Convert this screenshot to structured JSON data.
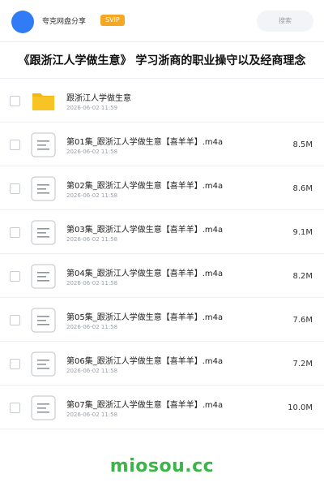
{
  "header": {
    "app_name": "夸克网盘分享",
    "badge": "SVIP",
    "search_placeholder": "搜索"
  },
  "title": "《跟浙江人学做生意》 学习浙商的职业操守以及经商理念",
  "items": [
    {
      "type": "folder",
      "name": "跟浙江人学做生意",
      "date": "2026-06-02 11:59",
      "size": ""
    },
    {
      "type": "file",
      "name": "第01集_跟浙江人学做生意【喜羊羊】.m4a",
      "date": "2026-06-02 11:58",
      "size": "8.5M"
    },
    {
      "type": "file",
      "name": "第02集_跟浙江人学做生意【喜羊羊】.m4a",
      "date": "2026-06-02 11:58",
      "size": "8.6M"
    },
    {
      "type": "file",
      "name": "第03集_跟浙江人学做生意【喜羊羊】.m4a",
      "date": "2026-06-02 11:58",
      "size": "9.1M"
    },
    {
      "type": "file",
      "name": "第04集_跟浙江人学做生意【喜羊羊】.m4a",
      "date": "2026-06-02 11:58",
      "size": "8.2M"
    },
    {
      "type": "file",
      "name": "第05集_跟浙江人学做生意【喜羊羊】.m4a",
      "date": "2026-06-02 11:58",
      "size": "7.6M"
    },
    {
      "type": "file",
      "name": "第06集_跟浙江人学做生意【喜羊羊】.m4a",
      "date": "2026-06-02 11:58",
      "size": "7.2M"
    },
    {
      "type": "file",
      "name": "第07集_跟浙江人学做生意【喜羊羊】.m4a",
      "date": "2026-06-02 11:58",
      "size": "10.0M"
    }
  ],
  "watermark": "miosou.cc",
  "colors": {
    "accent": "#2f7cf6",
    "svip": "#f5a623",
    "folder": "#f7c325",
    "watermark": "#3bb54a"
  }
}
